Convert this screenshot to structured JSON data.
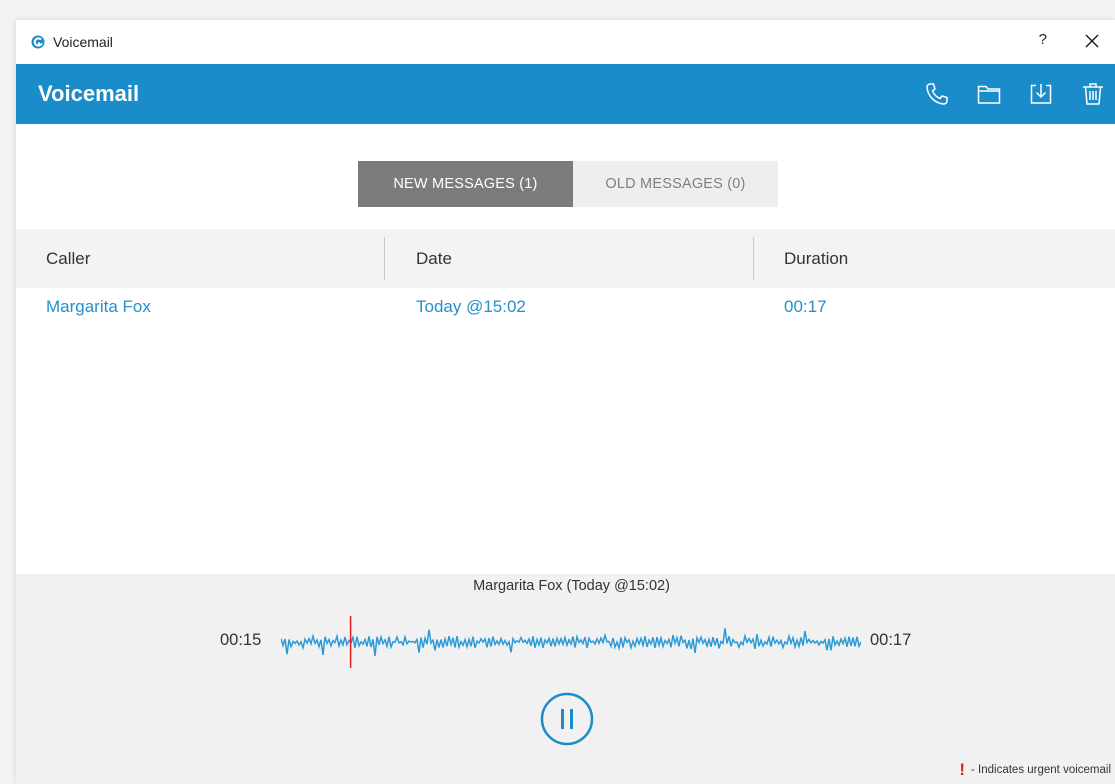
{
  "window": {
    "title": "Voicemail",
    "help_label": "?"
  },
  "header": {
    "title": "Voicemail",
    "actions": [
      "phone-icon",
      "folder-icon",
      "download-icon",
      "trash-icon"
    ]
  },
  "tabs": [
    {
      "label": "NEW MESSAGES (1)",
      "active": true
    },
    {
      "label": "OLD MESSAGES (0)",
      "active": false
    }
  ],
  "table": {
    "columns": [
      "Caller",
      "Date",
      "Duration"
    ],
    "rows": [
      {
        "caller": "Margarita Fox",
        "date": "Today @15:02",
        "duration": "00:17"
      }
    ]
  },
  "player": {
    "now_playing": "Margarita Fox (Today @15:02)",
    "elapsed": "00:15",
    "total": "00:17",
    "progress": 0.12,
    "state": "playing"
  },
  "legend": {
    "symbol": "!",
    "text": "- Indicates urgent voicemail"
  },
  "colors": {
    "accent": "#1a8cca",
    "link": "#2390d0",
    "waveform": "#2d9ad8",
    "playhead": "#e02020",
    "tab_active": "#7b7b7b"
  }
}
